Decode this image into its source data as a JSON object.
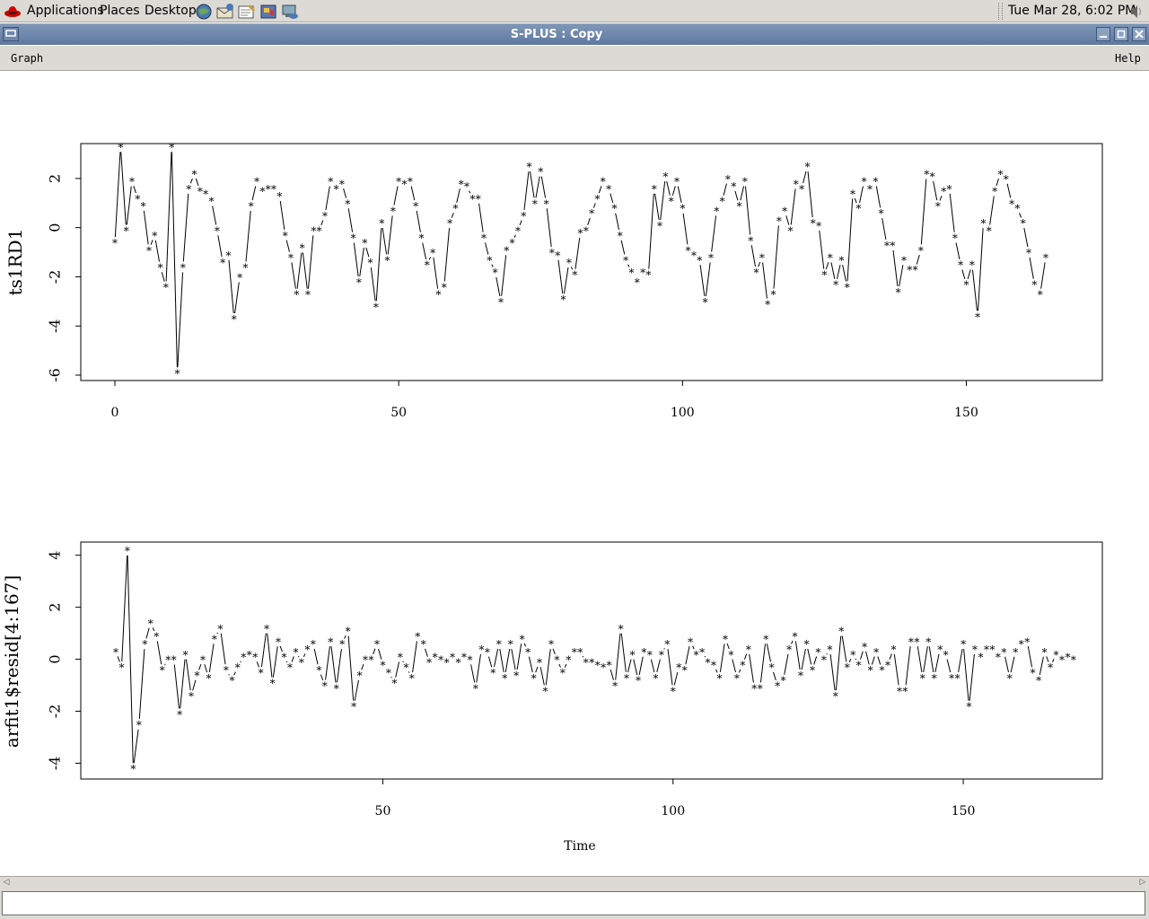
{
  "topbar": {
    "menus": [
      "Applications",
      "Places",
      "Desktop"
    ],
    "clock": "Tue Mar 28,  6:02 PM",
    "launchers": [
      "web-browser-icon",
      "mail-icon",
      "text-editor-icon",
      "presentation-icon",
      "network-icon"
    ]
  },
  "window": {
    "title": "S-PLUS : Copy",
    "buttons": [
      "minimize",
      "maximize",
      "close"
    ]
  },
  "menubar": {
    "graph": "Graph",
    "help": "Help"
  },
  "chart_data": [
    {
      "type": "line",
      "ylabel": "ts1RD1",
      "xlabel": "",
      "xlim": [
        0,
        167
      ],
      "ylim": [
        -6,
        3.2
      ],
      "xticks": [
        0,
        50,
        100,
        150
      ],
      "yticks": [
        -6,
        -4,
        -2,
        0,
        2
      ],
      "series": [
        {
          "values": [
            -0.6,
            3.3,
            -0.1,
            1.9,
            1.2,
            0.9,
            -0.9,
            -0.3,
            -1.6,
            -2.4,
            3.3,
            -5.9,
            -1.6,
            1.6,
            2.2,
            1.5,
            1.4,
            1.1,
            -0.1,
            -1.4,
            -1.1,
            -3.7,
            -2.0,
            -1.6,
            0.9,
            1.9,
            1.5,
            1.6,
            1.6,
            1.3,
            -0.3,
            -1.2,
            -2.7,
            -0.8,
            -2.7,
            -0.1,
            -0.1,
            0.5,
            1.9,
            1.6,
            1.8,
            1.0,
            -0.4,
            -2.2,
            -0.6,
            -1.4,
            -3.2,
            0.2,
            -1.3,
            0.7,
            1.9,
            1.8,
            1.9,
            0.9,
            -0.4,
            -1.5,
            -1.0,
            -2.7,
            -2.4,
            0.2,
            0.8,
            1.8,
            1.7,
            1.2,
            1.2,
            -0.4,
            -1.3,
            -1.8,
            -3.0,
            -0.9,
            -0.6,
            -0.1,
            0.5,
            2.5,
            1.0,
            2.3,
            1.0,
            -1.0,
            -1.1,
            -2.9,
            -1.4,
            -1.9,
            -0.2,
            -0.1,
            0.6,
            1.2,
            1.9,
            1.6,
            0.8,
            -0.3,
            -1.3,
            -1.8,
            -2.2,
            -1.8,
            -1.9,
            1.6,
            0.1,
            2.1,
            1.1,
            1.9,
            0.8,
            -0.9,
            -1.1,
            -1.3,
            -3.0,
            -1.2,
            0.7,
            1.1,
            2.0,
            1.7,
            0.9,
            1.9,
            -0.5,
            -1.8,
            -1.2,
            -3.1,
            -2.7,
            0.3,
            0.7,
            -0.1,
            1.8,
            1.6,
            2.5,
            0.2,
            0.1,
            -1.9,
            -1.2,
            -2.3,
            -1.3,
            -2.4,
            1.4,
            0.8,
            1.9,
            1.6,
            1.9,
            0.6,
            -0.7,
            -0.7,
            -2.6,
            -1.3,
            -1.7,
            -1.7,
            -0.9,
            2.2,
            2.1,
            0.9,
            1.5,
            1.6,
            -0.4,
            -1.5,
            -2.3,
            -1.5,
            -3.6,
            0.2,
            -0.1,
            1.5,
            2.2,
            2.0,
            1.0,
            0.8,
            0.2,
            -1.0,
            -2.3,
            -2.7,
            -1.2
          ]
        }
      ]
    },
    {
      "type": "line",
      "ylabel": "arfit1$resid[4:167]",
      "xlabel": "Time",
      "xlim": [
        4,
        167
      ],
      "ylim": [
        -4.4,
        4.3
      ],
      "xticks": [
        50,
        100,
        150
      ],
      "yticks": [
        -4,
        -2,
        0,
        2,
        4
      ],
      "series": [
        {
          "values": [
            0.3,
            -0.3,
            4.2,
            -4.2,
            -2.5,
            0.6,
            1.4,
            0.9,
            -0.4,
            0.0,
            0.0,
            -2.1,
            0.2,
            -1.4,
            -0.6,
            0.0,
            -0.7,
            0.8,
            1.2,
            -0.4,
            -0.8,
            -0.3,
            0.1,
            0.2,
            0.1,
            -0.5,
            1.2,
            -0.9,
            0.7,
            0.1,
            -0.3,
            0.3,
            -0.1,
            0.4,
            0.6,
            -0.4,
            -1.0,
            0.7,
            -1.1,
            0.6,
            1.1,
            -1.8,
            -0.6,
            0.0,
            0.0,
            0.6,
            -0.2,
            -0.5,
            -0.9,
            0.1,
            -0.3,
            -0.7,
            0.9,
            0.6,
            -0.1,
            0.1,
            0.0,
            -0.1,
            0.1,
            -0.1,
            0.1,
            0.0,
            -1.1,
            0.4,
            0.3,
            -0.5,
            0.6,
            -0.7,
            0.6,
            -0.6,
            0.8,
            0.3,
            -0.7,
            -0.1,
            -1.2,
            0.6,
            0.0,
            -0.5,
            0.0,
            0.3,
            0.3,
            -0.1,
            -0.1,
            -0.2,
            -0.3,
            -0.2,
            -1.0,
            1.2,
            -0.7,
            0.2,
            -0.8,
            0.3,
            0.2,
            -0.7,
            0.2,
            0.6,
            -1.2,
            -0.3,
            -0.4,
            0.7,
            0.2,
            0.3,
            -0.1,
            -0.2,
            -0.7,
            0.8,
            0.2,
            -0.7,
            -0.2,
            0.4,
            -1.1,
            -1.1,
            0.8,
            -0.3,
            -1.0,
            -0.8,
            0.4,
            0.9,
            -0.6,
            0.6,
            -0.4,
            0.3,
            0.0,
            0.4,
            -1.4,
            1.1,
            -0.3,
            0.2,
            -0.2,
            0.5,
            -0.4,
            0.3,
            -0.4,
            -0.2,
            0.4,
            -1.2,
            -1.2,
            0.7,
            0.7,
            -0.7,
            0.7,
            -0.7,
            0.4,
            0.2,
            -0.7,
            -0.7,
            0.6,
            -1.8,
            0.4,
            0.1,
            0.4,
            0.4,
            0.1,
            0.3,
            -0.7,
            0.3,
            0.6,
            0.7,
            -0.5,
            -0.8,
            0.3,
            -0.3,
            0.2,
            0.0,
            0.1,
            0.0
          ]
        }
      ]
    }
  ]
}
